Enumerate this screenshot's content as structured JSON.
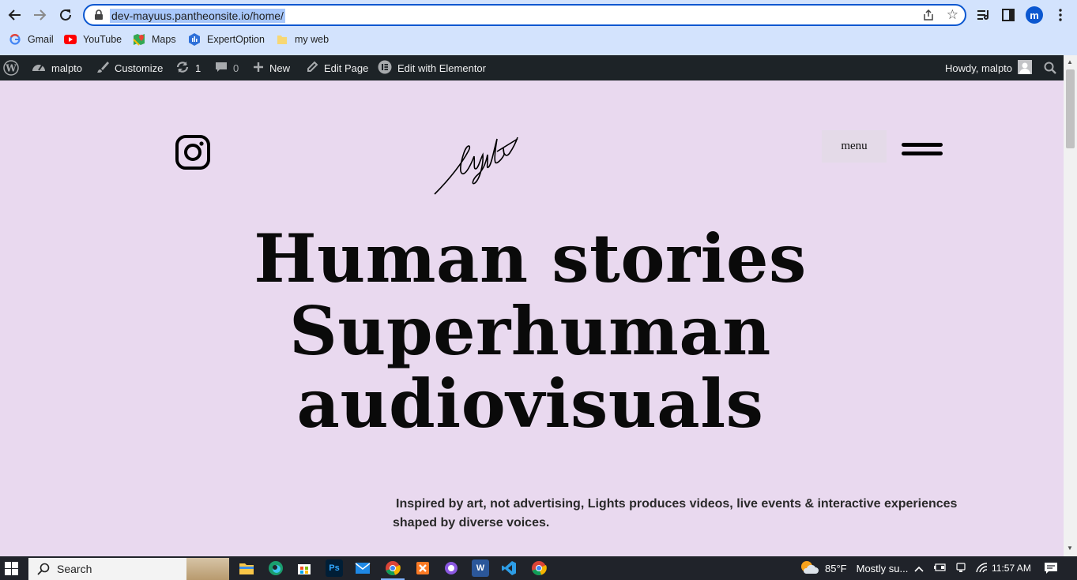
{
  "browser": {
    "url": "dev-mayuus.pantheonsite.io/home/",
    "profile_initial": "m",
    "bookmarks": [
      {
        "label": "Gmail",
        "icon": "google-icon"
      },
      {
        "label": "YouTube",
        "icon": "youtube-icon"
      },
      {
        "label": "Maps",
        "icon": "maps-icon"
      },
      {
        "label": "ExpertOption",
        "icon": "expertoption-icon"
      },
      {
        "label": "my web",
        "icon": "folder-icon"
      }
    ]
  },
  "wp_admin_bar": {
    "site_name": "malpto",
    "customize": "Customize",
    "updates_count": "1",
    "comments_count": "0",
    "new": "New",
    "edit_page": "Edit Page",
    "edit_elementor": "Edit with Elementor",
    "howdy": "Howdy, malpto"
  },
  "site": {
    "logo_text": "lights",
    "menu_label": "menu",
    "hero_lines": [
      "Human stories",
      "Superhuman",
      "audiovisuals"
    ],
    "tagline": "Inspired by art, not advertising, Lights produces videos, live events & interactive experiences shaped by diverse voices."
  },
  "taskbar": {
    "search_label": "Search",
    "temperature": "85°F",
    "weather": "Mostly su...",
    "time": "11:57 AM"
  },
  "colors": {
    "page_bg": "#e9d9ef",
    "wp_bar": "#1d2327",
    "chrome_bg": "#d3e3fd",
    "accent": "#0b57d0"
  }
}
